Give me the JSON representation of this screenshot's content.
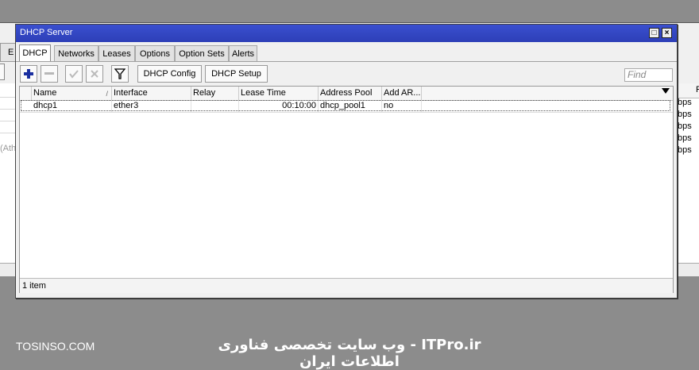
{
  "background": {
    "tab_label": "E",
    "partial_text": "(Ath",
    "rates": [
      "bps",
      "bps",
      "bps",
      "bps",
      "bps"
    ],
    "col_letter": "F"
  },
  "window": {
    "title": "DHCP Server",
    "maximize_glyph": "□",
    "close_glyph": "×"
  },
  "tabs": [
    {
      "label": "DHCP",
      "active": true
    },
    {
      "label": "Networks"
    },
    {
      "label": "Leases"
    },
    {
      "label": "Options"
    },
    {
      "label": "Option Sets"
    },
    {
      "label": "Alerts"
    }
  ],
  "toolbar": {
    "add_icon": "plus-icon",
    "remove_icon": "minus-icon",
    "enable_icon": "check-icon",
    "disable_icon": "x-icon",
    "filter_icon": "filter-icon",
    "dhcp_config_label": "DHCP Config",
    "dhcp_setup_label": "DHCP Setup",
    "find_placeholder": "Find"
  },
  "table": {
    "columns": [
      "Name",
      "Interface",
      "Relay",
      "Lease Time",
      "Address Pool",
      "Add AR..."
    ],
    "sorted_indicator": "/",
    "rows": [
      {
        "name": "dhcp1",
        "interface": "ether3",
        "relay": "",
        "lease_time": "00:10:00",
        "address_pool": "dhcp_pool1",
        "add_arp": "no"
      }
    ],
    "status": "1 item"
  },
  "watermark": {
    "left": "TOSINSO.COM",
    "right": "ITPro.ir - وب سایت تخصصی فناوری اطلاعات ایران"
  },
  "colors": {
    "titlebar": "#2d3fb7",
    "add_icon": "#1a2fa0"
  }
}
